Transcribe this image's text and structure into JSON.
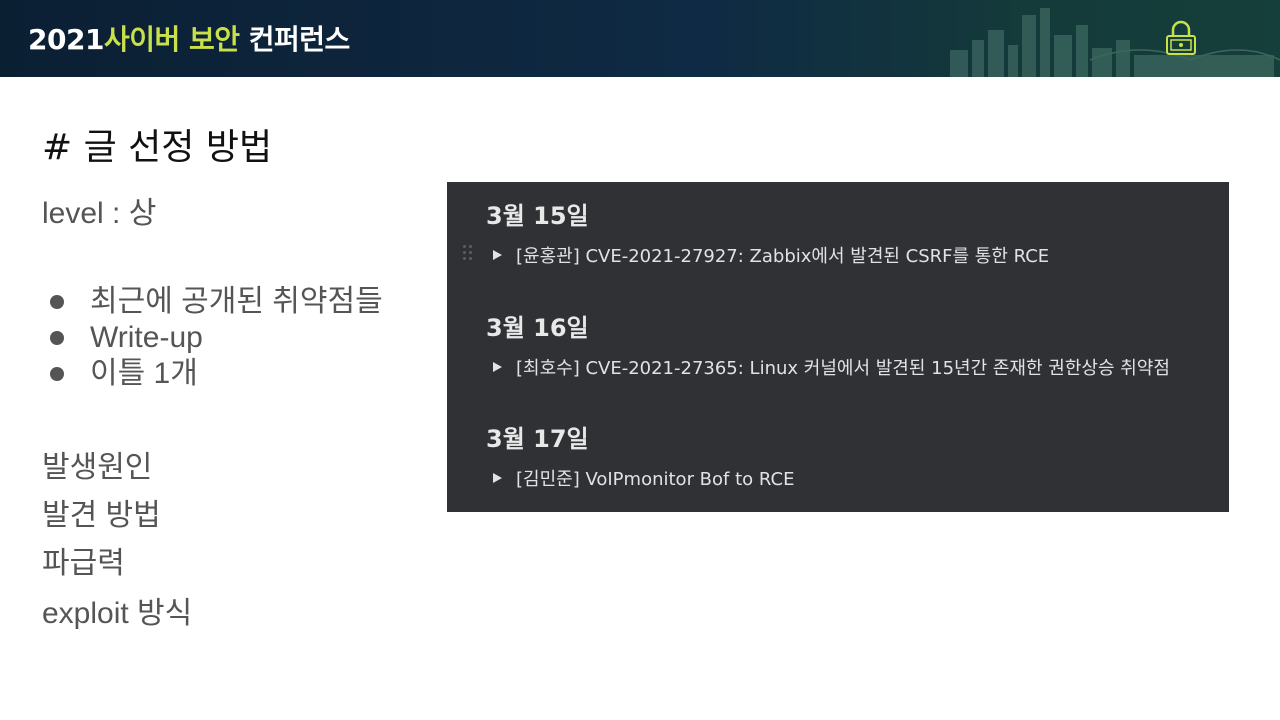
{
  "banner": {
    "year": "2021",
    "highlight": "사이버 보안",
    "suffix": " 컨퍼런스",
    "accent_color": "#c8e04a"
  },
  "slide": {
    "heading": "# 글 선정 방법",
    "level": "level : 상",
    "bullets": [
      "최근에 공개된 취약점들",
      "Write-up",
      "이틀 1개"
    ],
    "criteria": [
      "발생원인",
      "발견 방법",
      "파급력",
      "exploit 방식"
    ]
  },
  "panel": {
    "sections": [
      {
        "date": "3월 15일",
        "entry": "[윤홍관] CVE-2021-27927: Zabbix에서 발견된 CSRF를 통한 RCE"
      },
      {
        "date": "3월 16일",
        "entry": "[최호수] CVE-2021-27365: Linux 커널에서 발견된 15년간 존재한 권한상승 취약점"
      },
      {
        "date": "3월 17일",
        "entry": "[김민준] VoIPmonitor Bof to RCE"
      }
    ]
  }
}
